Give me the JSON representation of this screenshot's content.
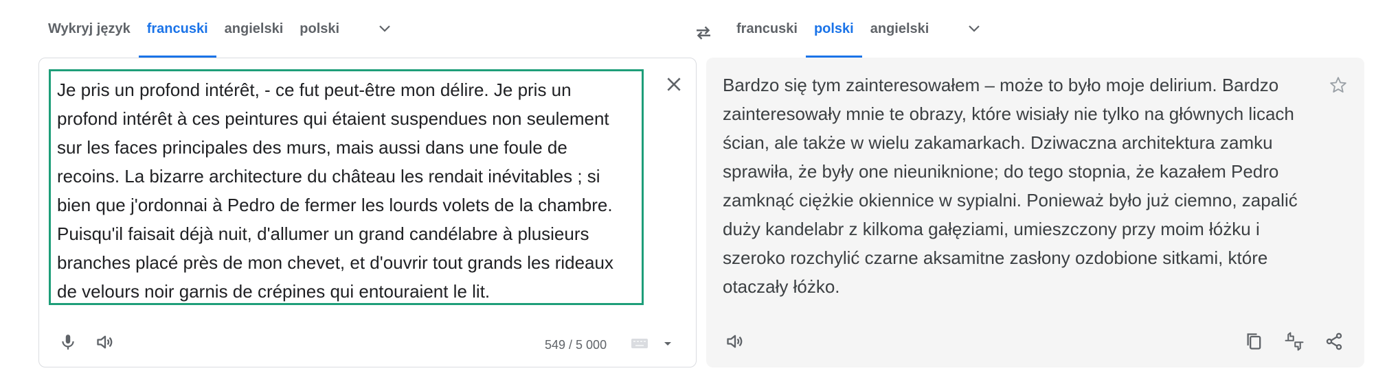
{
  "source_languages": {
    "tabs": [
      {
        "label": "Wykryj język",
        "active": false
      },
      {
        "label": "francuski",
        "active": true
      },
      {
        "label": "angielski",
        "active": false
      },
      {
        "label": "polski",
        "active": false
      }
    ],
    "more_icon": "chevron-down-icon"
  },
  "swap_icon": "swap-arrows-icon",
  "target_languages": {
    "tabs": [
      {
        "label": "francuski",
        "active": false
      },
      {
        "label": "polski",
        "active": true
      },
      {
        "label": "angielski",
        "active": false
      }
    ],
    "more_icon": "chevron-down-icon"
  },
  "source_panel": {
    "text": "Je pris un profond intérêt, - ce fut peut-être mon délire. Je pris un profond intérêt à ces peintures qui étaient suspendues non seulement sur les faces principales des murs, mais aussi dans une foule de recoins. La bizarre architecture du château les rendait inévitables ; si bien que j'ordonnai à Pedro de fermer les lourds volets de la chambre. Puisqu'il faisait déjà nuit, d'allumer un grand candélabre à plusieurs branches placé près de mon chevet, et d'ouvrir tout grands les rideaux de velours noir garnis de crépines qui entouraient le lit.",
    "char_count": "549 / 5 000",
    "icons": [
      "close-icon",
      "microphone-icon",
      "speaker-icon",
      "keyboard-icon",
      "dropdown-arrow-icon"
    ]
  },
  "target_panel": {
    "text": "Bardzo się tym zainteresowałem – może to było moje delirium. Bardzo zainteresowały mnie te obrazy, które wisiały nie tylko na głównych licach ścian, ale także w wielu zakamarkach. Dziwaczna architektura zamku sprawiła, że były one nieuniknione; do tego stopnia, że kazałem Pedro zamknąć ciężkie okiennice w sypialni. Ponieważ było już ciemno, zapalić duży kandelabr z kilkoma gałęziami, umieszczony przy moim łóżku i szeroko rozchylić czarne aksamitne zasłony ozdobione sitkami, które otaczały łóżko.",
    "icons": [
      "star-icon",
      "speaker-icon",
      "copy-icon",
      "feedback-icon",
      "share-icon"
    ]
  },
  "colors": {
    "accent": "#1a73e8",
    "selection_border": "#1e9e79",
    "target_background": "#f5f5f5",
    "icon": "#5f6368"
  }
}
